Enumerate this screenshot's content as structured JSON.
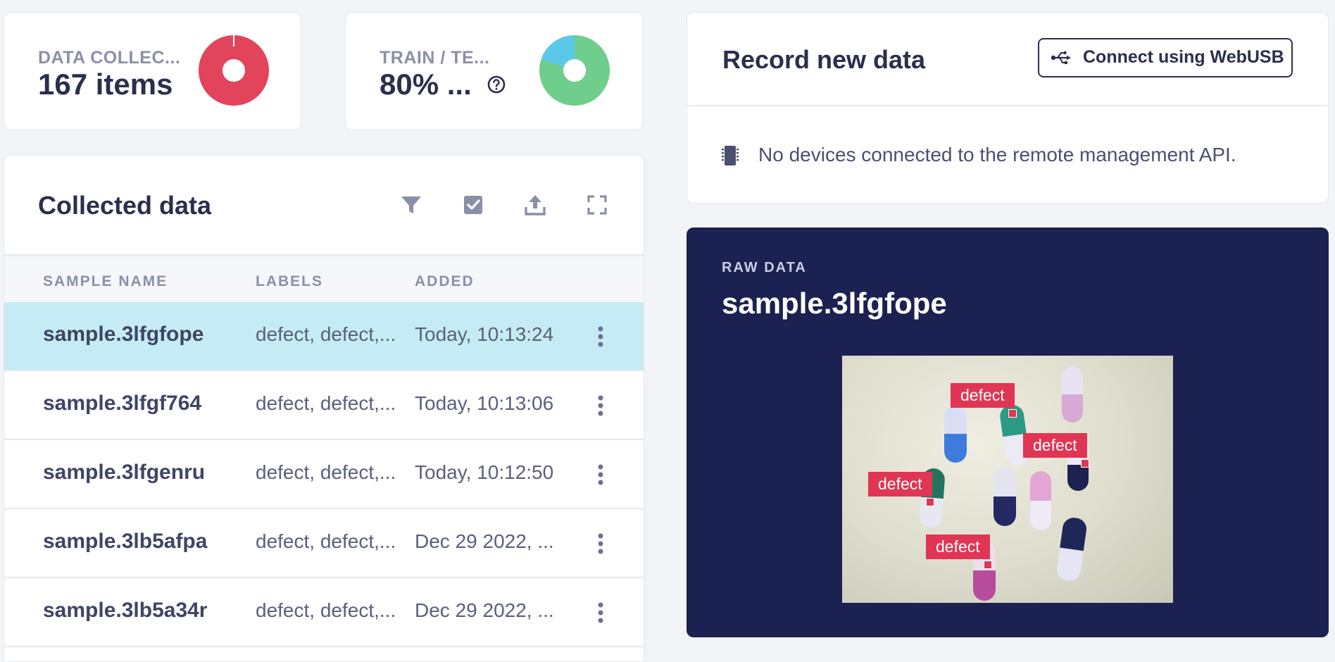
{
  "stats": {
    "data_collected": {
      "label": "DATA COLLEC...",
      "value": "167 items",
      "pie_color": "#e2445c",
      "fraction": 0.99
    },
    "train_test": {
      "label": "TRAIN / TE...",
      "value": "80% ...",
      "help_icon": "question-circle-icon",
      "train_color": "#6fce8b",
      "test_color": "#5bc8ea",
      "train_fraction": 0.8
    }
  },
  "collected": {
    "title": "Collected data",
    "toolbar_icons": [
      "filter-icon",
      "select-checkbox-icon",
      "upload-icon",
      "fullscreen-icon"
    ],
    "columns": [
      "SAMPLE NAME",
      "LABELS",
      "ADDED"
    ],
    "rows": [
      {
        "name": "sample.3lfgfope",
        "labels": "defect, defect,...",
        "added": "Today, 10:13:24",
        "selected": true
      },
      {
        "name": "sample.3lfgf764",
        "labels": "defect, defect,...",
        "added": "Today, 10:13:06",
        "selected": false
      },
      {
        "name": "sample.3lfgenru",
        "labels": "defect, defect,...",
        "added": "Today, 10:12:50",
        "selected": false
      },
      {
        "name": "sample.3lb5afpa",
        "labels": "defect, defect,...",
        "added": "Dec 29 2022, ...",
        "selected": false
      },
      {
        "name": "sample.3lb5a34r",
        "labels": "defect, defect,...",
        "added": "Dec 29 2022, ...",
        "selected": false
      }
    ]
  },
  "record": {
    "title": "Record new data",
    "connect_button": "Connect using WebUSB",
    "connect_icon": "usb-icon",
    "status_icon": "chip-icon",
    "status": "No devices connected to the remote management API."
  },
  "raw": {
    "label": "RAW DATA",
    "title": "sample.3lfgfope",
    "boxes": [
      {
        "label": "defect"
      },
      {
        "label": "defect"
      },
      {
        "label": "defect"
      },
      {
        "label": "defect"
      }
    ]
  },
  "colors": {
    "accent_dark": "#1b2150",
    "selected_row": "#c5ecf5",
    "bbox": "#e03553"
  }
}
